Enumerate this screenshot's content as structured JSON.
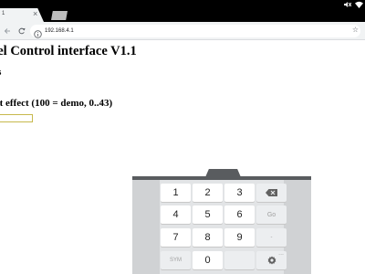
{
  "browser": {
    "tab_title": "1",
    "tab_close": "×",
    "url": "192.168.4.1",
    "star": "☆"
  },
  "page": {
    "title": "xel Control interface V1.1",
    "subtitle": "ess",
    "field_label": "ght effect (100 = demo, 0..43)",
    "field_value": ""
  },
  "keyboard": {
    "row1": [
      "1",
      "2",
      "3"
    ],
    "row2": [
      "4",
      "5",
      "6"
    ],
    "row3": [
      "7",
      "8",
      "9"
    ],
    "row4_zero": "0",
    "sym_label": "SYM",
    "go_label": "Go",
    "dash_label": "-",
    "more": "..."
  },
  "colors": {
    "input_border": "#c7b94d",
    "keyboard_frame": "#595c5f",
    "keyboard_background": "#e2e4e6"
  },
  "icons": {
    "status": [
      "mute-icon",
      "wifi-icon"
    ],
    "toolbar": [
      "back-arrow-icon",
      "forward-arrow-icon",
      "reload-icon",
      "info-icon"
    ],
    "keyboard": [
      "backspace-icon",
      "settings-gear-icon"
    ]
  }
}
